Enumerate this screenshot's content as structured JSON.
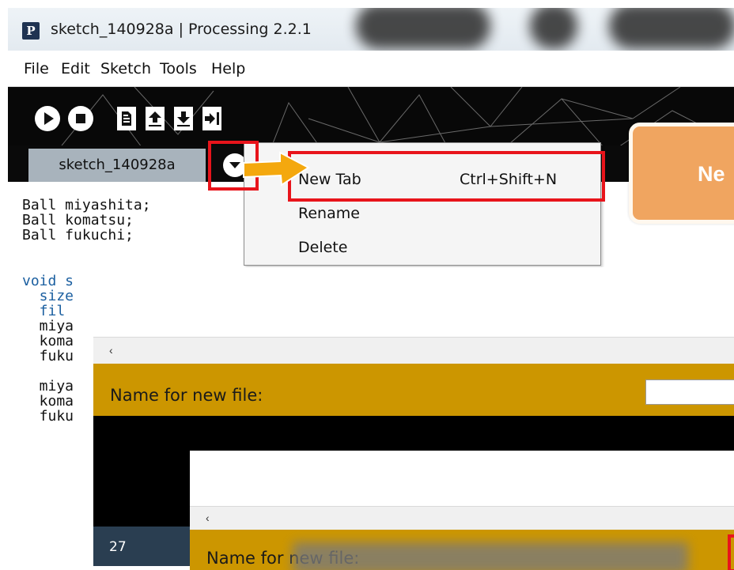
{
  "window": {
    "title": "sketch_140928a | Processing 2.2.1",
    "app_icon_letter": "P"
  },
  "menubar": {
    "items": [
      "File",
      "Edit",
      "Sketch",
      "Tools",
      "Help"
    ]
  },
  "toolbar": {
    "buttons": [
      {
        "name": "run-button",
        "icon": "play-icon"
      },
      {
        "name": "stop-button",
        "icon": "stop-icon"
      },
      {
        "name": "new-button",
        "icon": "new-file-icon"
      },
      {
        "name": "open-button",
        "icon": "open-arrow-up-icon"
      },
      {
        "name": "save-button",
        "icon": "save-arrow-down-icon"
      },
      {
        "name": "export-button",
        "icon": "export-arrow-right-icon"
      }
    ]
  },
  "tabs": {
    "active_tab": "sketch_140928a",
    "menu_button_icon": "chevron-down-icon"
  },
  "editor": {
    "lines": [
      "Ball miyashita;",
      "Ball komatsu;",
      "Ball fukuchi;",
      "",
      "void s",
      "  size",
      "  fil",
      "  miya",
      "  koma",
      "  fuku",
      "",
      "  miya",
      "  koma",
      "  fuku"
    ]
  },
  "context_menu": {
    "items": [
      {
        "label": "New Tab",
        "shortcut": "Ctrl+Shift+N"
      },
      {
        "label": "Rename",
        "shortcut": ""
      },
      {
        "label": "Delete",
        "shortcut": ""
      }
    ]
  },
  "callout": {
    "text": "Ne"
  },
  "prompt_panel": {
    "label": "Name for new file:",
    "input_value": "",
    "scroll_arrow": "‹"
  },
  "status": {
    "line_number": "27"
  },
  "prompt_panel_2": {
    "label": "Name for new file:",
    "scroll_arrow": "‹"
  },
  "colors": {
    "highlight_red": "#e8141b",
    "arrow_orange": "#f4a80e",
    "callout_orange": "#f0a560",
    "prompt_gold": "#cc9600",
    "status_blue": "#2a3e51",
    "tab_gray": "#a8b3bc"
  }
}
